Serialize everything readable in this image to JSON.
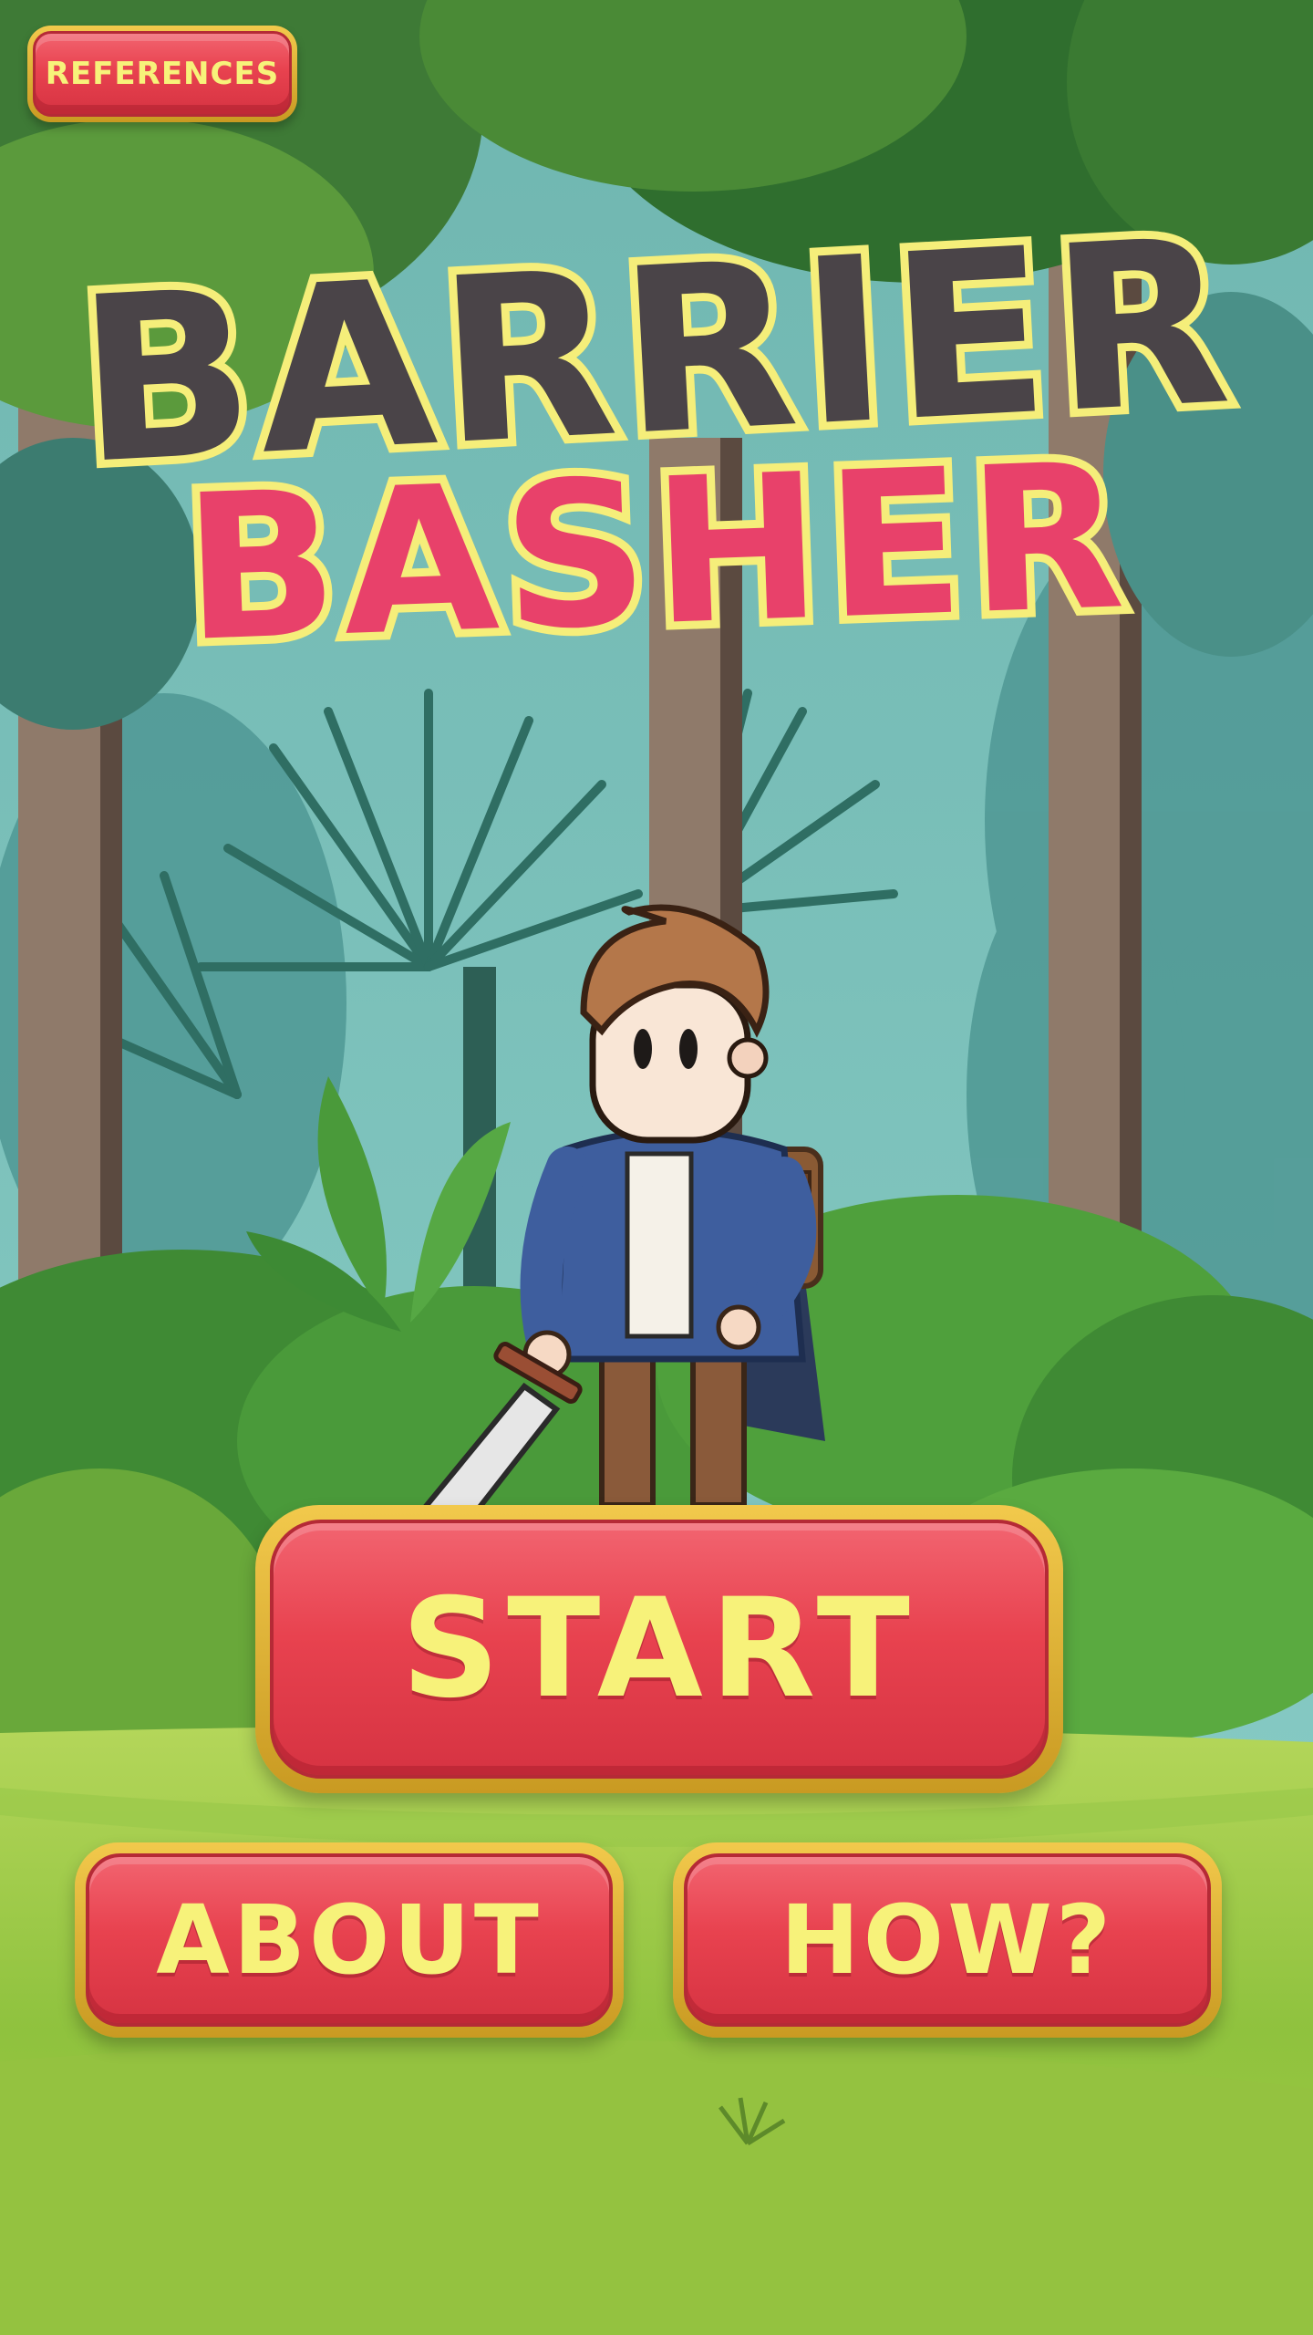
{
  "references_button": {
    "label": "REFERENCES"
  },
  "title": {
    "line1": "BARRIER",
    "line2": "BASHER"
  },
  "menu": {
    "start_label": "START",
    "about_label": "ABOUT",
    "how_label": "HOW?"
  },
  "colors": {
    "button_fill": "#e8424f",
    "button_border": "#f2c94c",
    "button_text": "#f7f27a",
    "title_dark": "#4a4448",
    "title_pink": "#e8416a",
    "title_outline": "#f5ee7a"
  },
  "icons": {
    "sword": "sword-icon",
    "backpack": "backpack-icon"
  }
}
